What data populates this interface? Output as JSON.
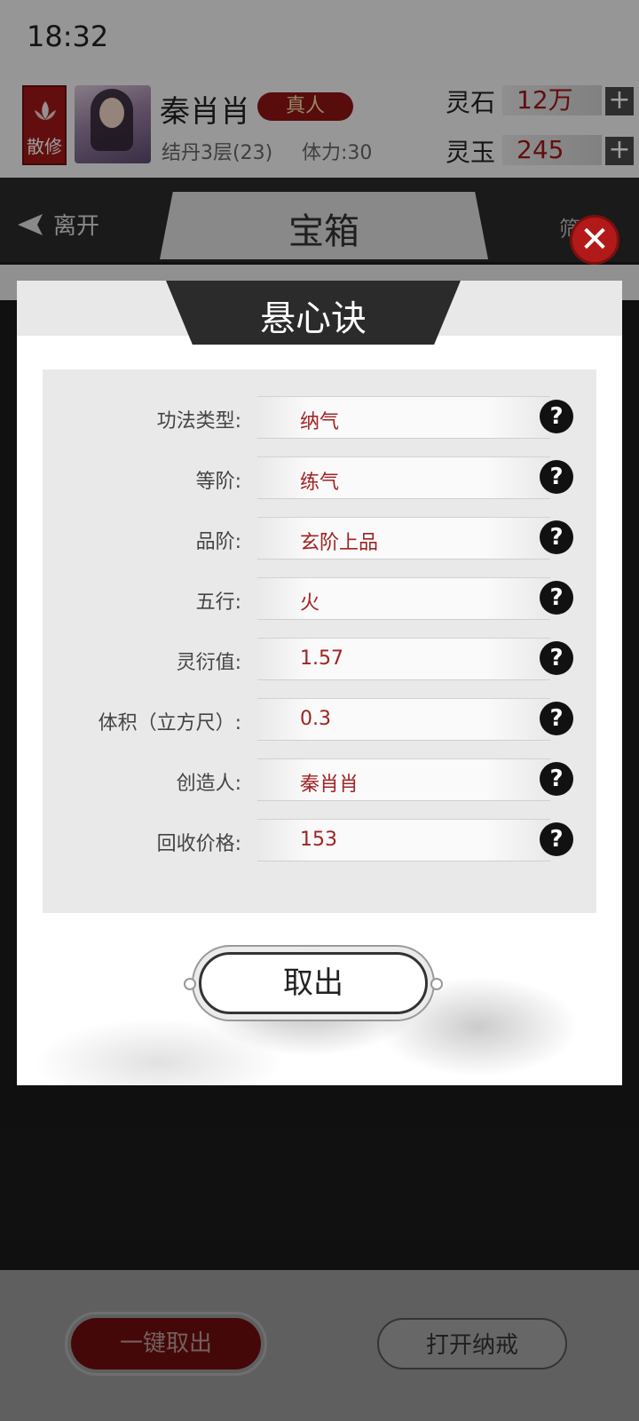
{
  "status_bar": {
    "time": "18:32"
  },
  "header": {
    "sect": "散修",
    "player_name": "秦肖肖",
    "real_badge": "真人",
    "level": "结丹3层(23)",
    "stamina": "体力:30",
    "resources": [
      {
        "label": "灵石",
        "value": "12万"
      },
      {
        "label": "灵玉",
        "value": "245"
      }
    ],
    "plus_symbol": "+"
  },
  "nav": {
    "leave_label": "离开",
    "title": "宝箱",
    "filter_label": "筛"
  },
  "dialog": {
    "title": "悬心诀",
    "rows": [
      {
        "label": "功法类型:",
        "value": "纳气"
      },
      {
        "label": "等阶:",
        "value": "练气"
      },
      {
        "label": "品阶:",
        "value": "玄阶上品"
      },
      {
        "label": "五行:",
        "value": "火"
      },
      {
        "label": "灵衍值:",
        "value": "1.57"
      },
      {
        "label": "体积（立方尺）:",
        "value": "0.3"
      },
      {
        "label": "创造人:",
        "value": "秦肖肖"
      },
      {
        "label": "回收价格:",
        "value": "153"
      }
    ],
    "help_symbol": "?",
    "take_out_label": "取出",
    "close_symbol": "✕"
  },
  "bottom": {
    "one_click_label": "一键取出",
    "open_ring_label": "打开纳戒"
  },
  "colors": {
    "accent_red": "#a01818",
    "dialog_bg": "#ffffff",
    "panel_bg": "#e9e9e9"
  }
}
